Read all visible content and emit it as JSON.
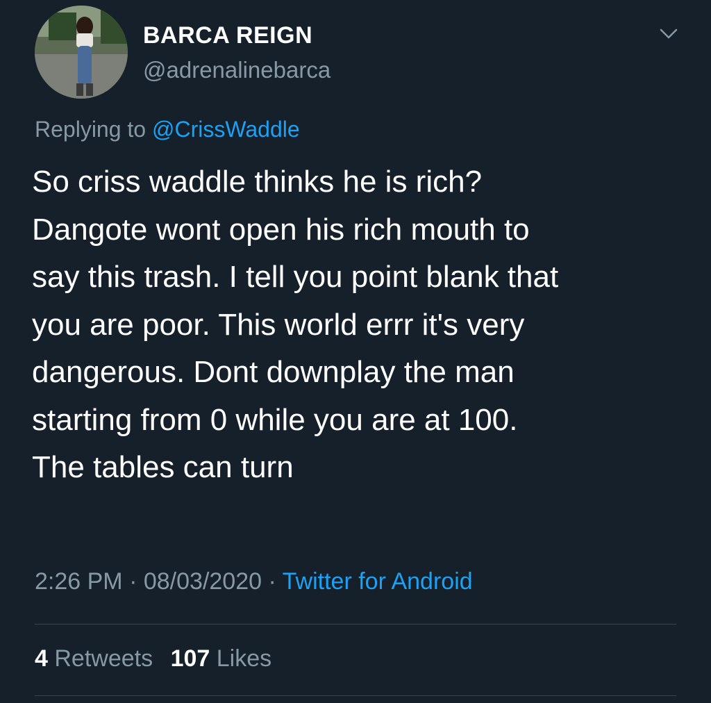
{
  "user": {
    "display_name": "BARCA REIGN",
    "handle": "@adrenalinebarca"
  },
  "header": {
    "menu_icon": "chevron-down-icon"
  },
  "reply": {
    "prefix": "Replying to",
    "mention": "@CrissWaddle"
  },
  "tweet": {
    "lines": [
      "So criss waddle thinks he is rich?",
      "Dangote wont open his rich mouth to",
      "say this trash. I tell you point blank that",
      "you are poor. This world errr it's very",
      "dangerous. Dont downplay the man",
      "starting from 0 while you are at 100.",
      "The tables can turn"
    ]
  },
  "meta": {
    "time": "2:26 PM",
    "separator": "·",
    "date": "08/03/2020",
    "source": "Twitter for Android"
  },
  "stats": {
    "retweets_count": "4",
    "retweets_label": "Retweets",
    "likes_count": "107",
    "likes_label": "Likes"
  },
  "colors": {
    "background": "#15202b",
    "text": "#ffffff",
    "muted": "#8899a6",
    "accent": "#1da1f2",
    "divider": "#38444d"
  }
}
